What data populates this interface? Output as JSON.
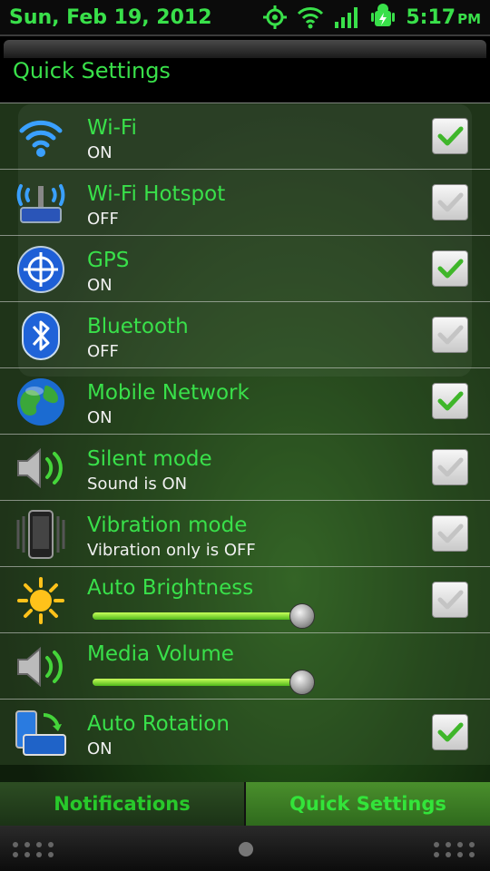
{
  "status_bar": {
    "date": "Sun, Feb 19, 2012",
    "time": "5:17",
    "ampm": "PM",
    "icons": [
      "gps-target-icon",
      "wifi-icon",
      "signal-icon",
      "battery-charging-android-icon"
    ]
  },
  "header": {
    "title": "Quick Settings"
  },
  "rows": [
    {
      "title": "Wi-Fi",
      "subtitle": "ON",
      "checked": true,
      "icon": "wifi-icon"
    },
    {
      "title": "Wi-Fi Hotspot",
      "subtitle": "OFF",
      "checked": false,
      "icon": "hotspot-icon"
    },
    {
      "title": "GPS",
      "subtitle": "ON",
      "checked": true,
      "icon": "gps-icon"
    },
    {
      "title": "Bluetooth",
      "subtitle": "OFF",
      "checked": false,
      "icon": "bluetooth-icon"
    },
    {
      "title": "Mobile Network",
      "subtitle": "ON",
      "checked": true,
      "icon": "globe-icon"
    },
    {
      "title": "Silent mode",
      "subtitle": "Sound is ON",
      "checked": false,
      "icon": "speaker-icon"
    },
    {
      "title": "Vibration mode",
      "subtitle": "Vibration only is OFF",
      "checked": false,
      "icon": "vibration-icon"
    },
    {
      "title": "Auto Brightness",
      "slider_level": 0.985,
      "checked": false,
      "icon": "sun-icon"
    },
    {
      "title": "Media Volume",
      "slider_level": 0.985,
      "icon": "speaker-icon"
    },
    {
      "title": "Auto Rotation",
      "subtitle": "ON",
      "checked": true,
      "icon": "rotation-icon"
    }
  ],
  "tabs": {
    "notifications": "Notifications",
    "quick_settings": "Quick Settings",
    "active": "quick_settings"
  },
  "colors": {
    "accent": "#39e04a",
    "tab_text": "#28c92b"
  }
}
